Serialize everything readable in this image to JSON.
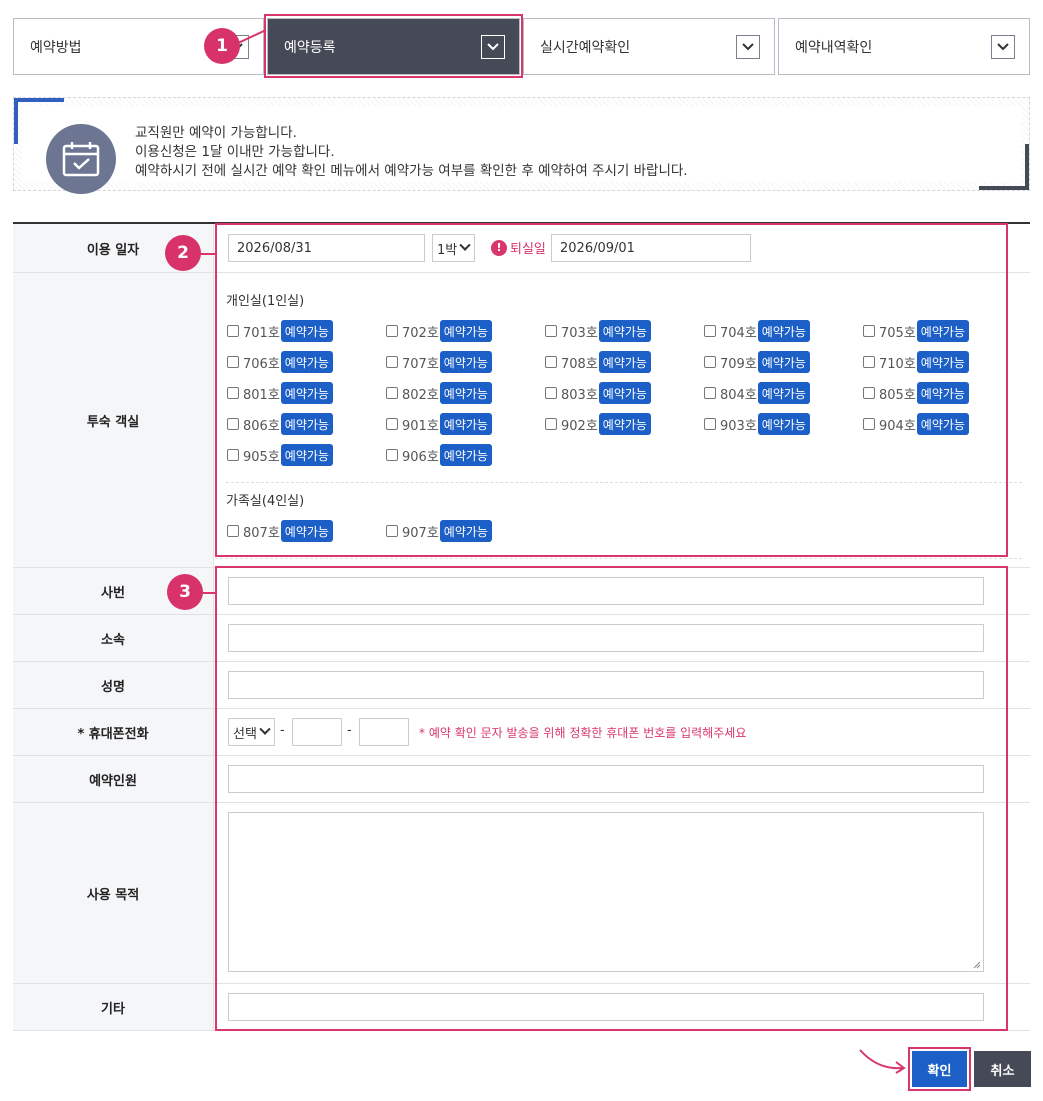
{
  "tabs": [
    {
      "label": "예약방법"
    },
    {
      "label": "예약등록"
    },
    {
      "label": "실시간예약확인"
    },
    {
      "label": "예약내역확인"
    }
  ],
  "markers": {
    "m1": "1",
    "m2": "2",
    "m3": "3"
  },
  "notice": {
    "line1": "교직원만 예약이 가능합니다.",
    "line2": "이용신청은 1달 이내만 가능합니다.",
    "line3": "예약하시기 전에 실시간 예약 확인 메뉴에서 예약가능 여부를 확인한 후 예약하여 주시기 바랍니다."
  },
  "date_row": {
    "label": "이용 일자",
    "date": "2026/08/31",
    "nights": "1박",
    "checkout_label": "퇴실일",
    "checkout_date": "2026/09/01"
  },
  "room_row": {
    "label": "투숙 객실",
    "single_title": "개인실(1인실)",
    "family_title": "가족실(4인실)",
    "tag": "예약가능",
    "single_rooms": [
      "701호",
      "702호",
      "703호",
      "704호",
      "705호",
      "706호",
      "707호",
      "708호",
      "709호",
      "710호",
      "801호",
      "802호",
      "803호",
      "804호",
      "805호",
      "806호",
      "901호",
      "902호",
      "903호",
      "904호",
      "905호",
      "906호"
    ],
    "family_rooms": [
      "807호",
      "907호"
    ]
  },
  "fields": {
    "employee_no": "사번",
    "department": "소속",
    "name": "성명",
    "phone": "* 휴대폰전화",
    "phone_select": "선택",
    "phone_dash": "-",
    "phone_note": "* 예약 확인 문자 발송을 위해 정확한 휴대폰 번호를 입력해주세요",
    "people": "예약인원",
    "purpose": "사용 목적",
    "etc": "기타"
  },
  "buttons": {
    "confirm": "확인",
    "cancel": "취소"
  },
  "colors": {
    "accent": "#d9366b",
    "tag": "#1c5fc7",
    "active_tab": "#454a56",
    "confirm": "#1c5fc7"
  }
}
